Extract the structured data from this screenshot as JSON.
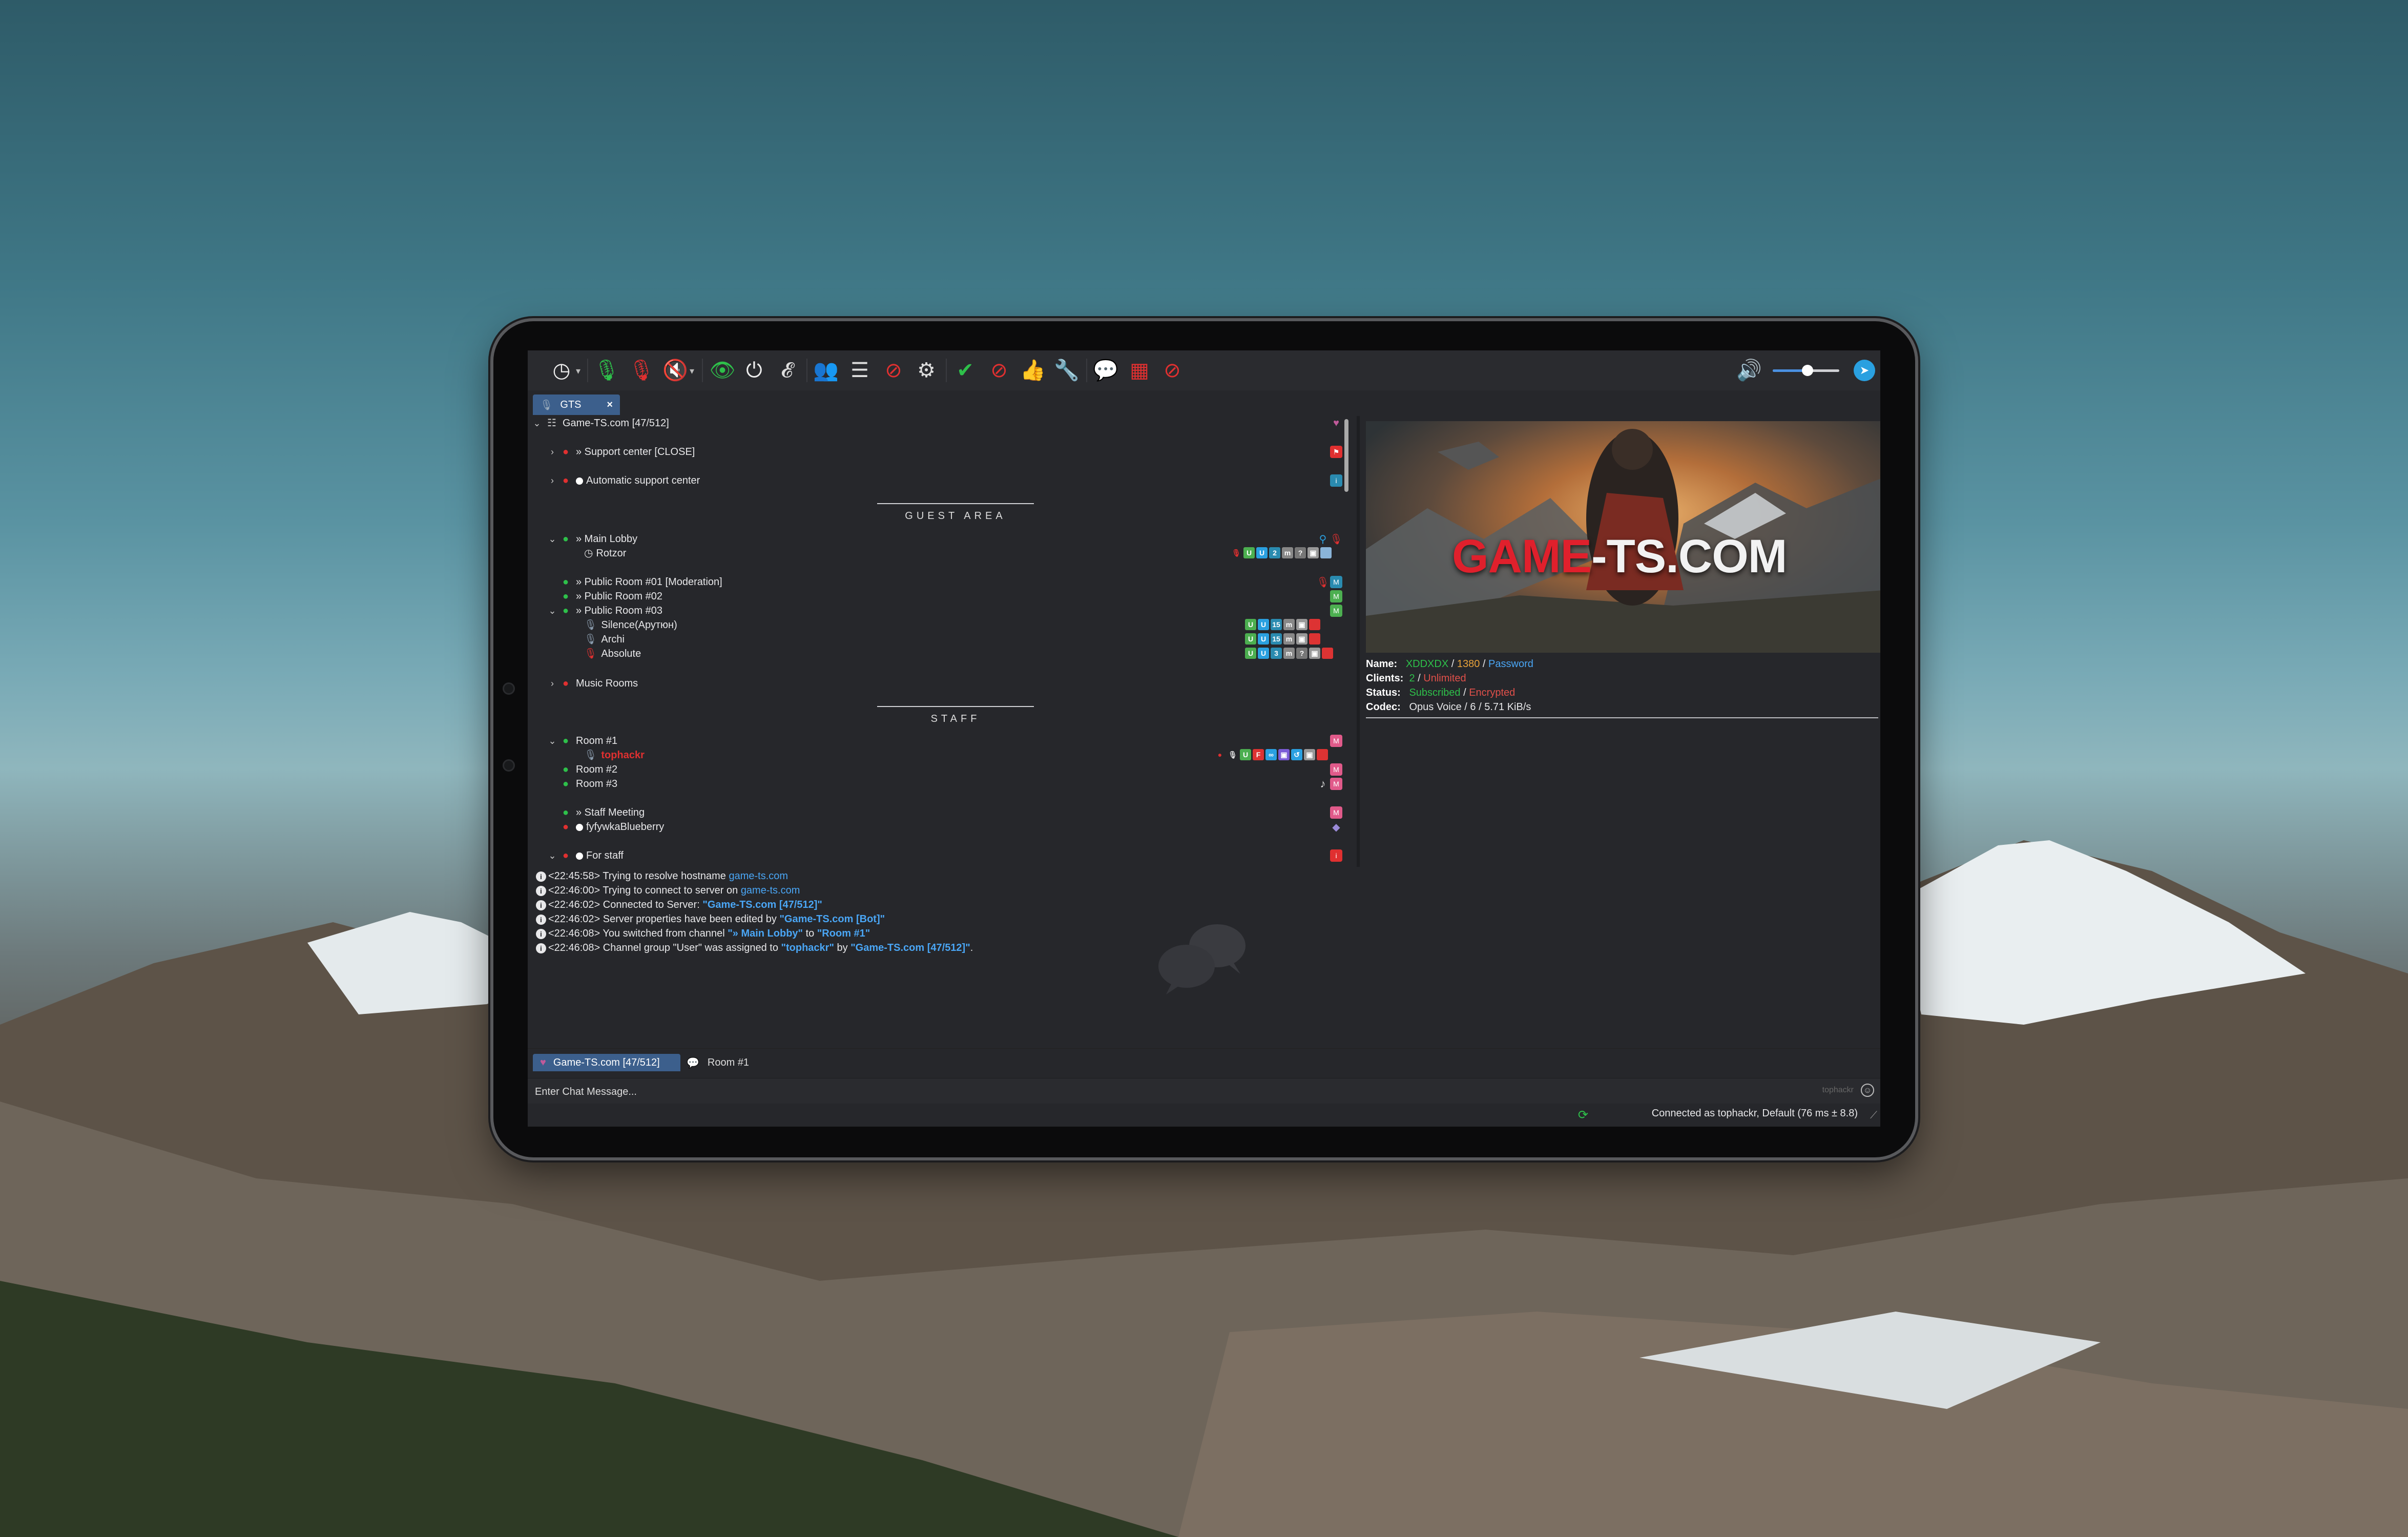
{
  "toolbar": {
    "icons": [
      "history-icon",
      "microphone-icon",
      "mic-muted-icon",
      "speaker-muted-icon",
      "eye-icon",
      "power-icon",
      "ear-icon",
      "contacts-icon",
      "server-list-icon",
      "block-icon",
      "settings-icon",
      "check-icon",
      "away-icon",
      "thumbs-up-icon",
      "wrench-icon",
      "chat-icon",
      "chat-box-icon",
      "no-chat-icon",
      "volume-icon",
      "telegram-icon"
    ],
    "volume_level": 0.52
  },
  "server_tab": {
    "label": "GTS",
    "close": "×"
  },
  "tree": {
    "server": "Game-TS.com [47/512]",
    "channels": [
      {
        "label": "» Support center [CLOSE]"
      },
      {
        "label": "Automatic support center"
      },
      {
        "spacer": "GUEST AREA"
      },
      {
        "label": "» Main Lobby"
      },
      {
        "user": "Rotzor"
      },
      {
        "label": "» Public Room #01 [Moderation]"
      },
      {
        "label": "» Public Room #02"
      },
      {
        "label": "» Public Room #03"
      },
      {
        "user": "Silence(Арутюн)"
      },
      {
        "user": "Archi"
      },
      {
        "user": "Absolute"
      },
      {
        "label": "Music Rooms"
      },
      {
        "spacer": "STAFF"
      },
      {
        "label": "Room #1"
      },
      {
        "user": "tophackr"
      },
      {
        "label": "Room #2"
      },
      {
        "label": "Room #3"
      },
      {
        "label": "» Staff Meeting"
      },
      {
        "label": "fyfywkaBlueberry"
      },
      {
        "label": "For staff"
      }
    ]
  },
  "info": {
    "banner_text_red": "GAME",
    "banner_text_white": "-TS.COM",
    "name_label": "Name:",
    "name_value": "XDDXDX",
    "name_sep1": "/",
    "name_port": "1380",
    "name_sep2": "/",
    "name_password": "Password",
    "clients_label": "Clients:",
    "clients_value": "2",
    "clients_sep": "/",
    "clients_max": "Unlimited",
    "status_label": "Status:",
    "status_value": "Subscribed",
    "status_sep": "/",
    "status_enc": "Encrypted",
    "codec_label": "Codec:",
    "codec_value": "Opus Voice / 6 / 5.71 KiB/s"
  },
  "log": [
    {
      "time": "<22:45:58>",
      "text": "Trying to resolve hostname ",
      "link": "game-ts.com",
      "rest": ""
    },
    {
      "time": "<22:46:00>",
      "text": "Trying to connect to server on ",
      "link": "game-ts.com",
      "rest": ""
    },
    {
      "time": "<22:46:02>",
      "text": "Connected to Server: ",
      "link": "\"Game-TS.com [47/512]\"",
      "rest": ""
    },
    {
      "time": "<22:46:02>",
      "text": "Server properties have been edited by ",
      "link": "\"Game-TS.com [Bot]\"",
      "rest": ""
    },
    {
      "time": "<22:46:08>",
      "text": "You switched from channel ",
      "link": "\"» Main Lobby\"",
      "mid": " to ",
      "link2": "\"Room #1\""
    },
    {
      "time": "<22:46:08>",
      "text": "Channel group \"User\" was assigned to ",
      "link": "\"tophackr\"",
      "mid": " by ",
      "link2": "\"Game-TS.com [47/512]\"",
      "rest": "."
    }
  ],
  "chat_tabs": [
    {
      "label": "Game-TS.com [47/512]"
    },
    {
      "label": "Room #1"
    }
  ],
  "chat_input": {
    "placeholder": "Enter Chat Message...",
    "user": "tophackr"
  },
  "status": {
    "text": "Connected as tophackr, Default (76 ms ± 8.8)"
  },
  "colors": {
    "accent": "#3c5f8c",
    "link": "#4aa6f5",
    "green": "#2ec04a",
    "red": "#e03030"
  }
}
